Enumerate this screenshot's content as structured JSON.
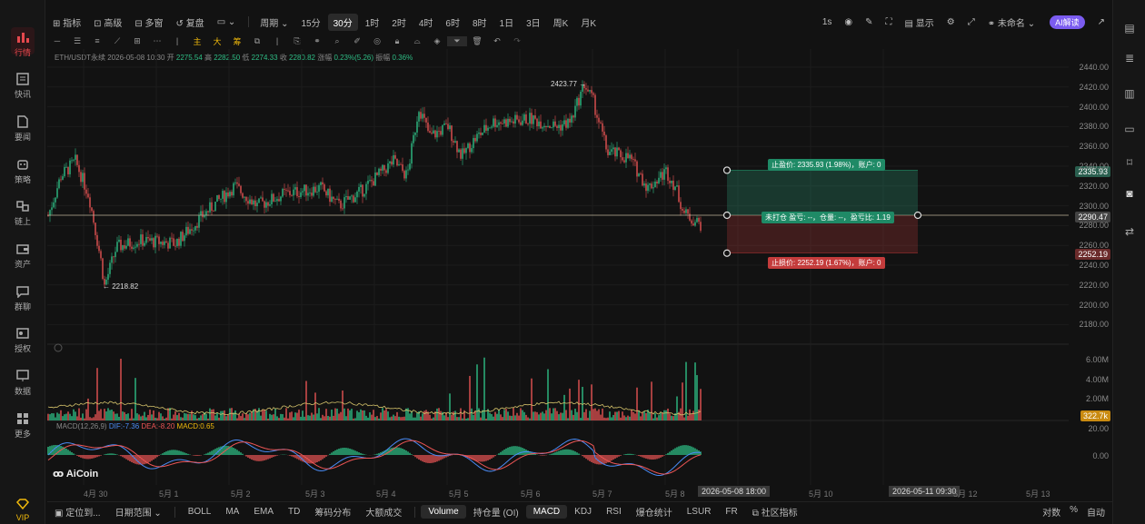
{
  "sidebar": {
    "items": [
      {
        "label": "行情",
        "icon": "bar-chart-icon",
        "active": true
      },
      {
        "label": "快讯",
        "icon": "news-icon"
      },
      {
        "label": "要闻",
        "icon": "document-icon"
      },
      {
        "label": "策略",
        "icon": "robot-icon"
      },
      {
        "label": "链上",
        "icon": "chain-icon"
      },
      {
        "label": "资产",
        "icon": "wallet-icon"
      },
      {
        "label": "群聊",
        "icon": "chat-icon"
      },
      {
        "label": "授权",
        "icon": "key-icon"
      },
      {
        "label": "数据",
        "icon": "monitor-icon"
      },
      {
        "label": "更多",
        "icon": "grid-icon"
      }
    ],
    "vip_label": "VIP"
  },
  "toolbar": {
    "indicators": "指标",
    "advanced": "高级",
    "multi_window": "多窗",
    "restore": "复盘",
    "period": "周期",
    "timeframes": [
      "15分",
      "30分",
      "1时",
      "2时",
      "4时",
      "6时",
      "8时",
      "1日",
      "3日",
      "周K",
      "月K"
    ],
    "selected_timeframe": "30分",
    "interval": "1s",
    "display": "显示",
    "unnamed": "未命名",
    "ai_button": "AI解读"
  },
  "drawing_tools": [
    "主",
    "大",
    "筹"
  ],
  "chart_info": {
    "symbol": "ETH/USDT永续",
    "time": "2026-05-08 10:30",
    "open_label": "开",
    "open": "2275.54",
    "high_label": "高",
    "high": "2282.50",
    "low_label": "低",
    "low": "2274.33",
    "close_label": "收",
    "close": "2280.82",
    "change_label": "涨幅",
    "change": "0.23%(5.26)",
    "amp_label": "振幅",
    "amp": "0.36%"
  },
  "price_axis": [
    "2440.00",
    "2420.00",
    "2400.00",
    "2380.00",
    "2360.00",
    "2340.00",
    "2320.00",
    "2300.00",
    "2280.00",
    "2260.00",
    "2240.00",
    "2220.00",
    "2200.00",
    "2180.00"
  ],
  "price_tags": {
    "take_profit": "2335.93",
    "current": "2290.47",
    "stop_loss": "2252.19"
  },
  "annotations": {
    "high": "2423.77",
    "low": "2218.82"
  },
  "position_tool": {
    "take_profit": "止盈价: 2335.93 (1.98%)，账户: 0",
    "open": "未打仓 盈亏: --，仓量: --，盈亏比: 1.19",
    "stop_loss": "止损价: 2252.19 (1.67%)，账户: 0"
  },
  "volume_axis": [
    "6.00M",
    "4.00M",
    "2.00M"
  ],
  "volume_tag": "322.7k",
  "macd": {
    "label": "MACD(12,26,9)",
    "dif": "DIF:-7.36",
    "dea": "DEA:-8.20",
    "macd": "MACD:0.65",
    "axis": [
      "20.00",
      "0.00"
    ]
  },
  "timeline": {
    "dates": [
      "4月 30",
      "5月 1",
      "5月 2",
      "5月 3",
      "5月 4",
      "5月 5",
      "5月 6",
      "5月 7",
      "5月 8",
      "5月 10",
      "5月 12",
      "5月 13"
    ],
    "cursor_label": "2026-05-08 18:00",
    "range_end_label": "2026-05-11 09:30"
  },
  "brand": "AiCoin",
  "bottom_bar": {
    "locate": "定位到...",
    "date_range": "日期范围",
    "indicators": [
      "BOLL",
      "MA",
      "EMA",
      "TD",
      "筹码分布",
      "大额成交",
      "Volume",
      "持仓量 (OI)",
      "MACD",
      "KDJ",
      "RSI",
      "爆仓统计",
      "LSUR",
      "FR"
    ],
    "selected": [
      "Volume",
      "MACD"
    ],
    "community": "社区指标",
    "right": [
      "对数",
      "%",
      "自动"
    ]
  },
  "colors": {
    "up": "#2ebd85",
    "down": "#e55353",
    "background": "#121212",
    "accent": "#7b5cf0"
  },
  "chart_data": {
    "type": "line",
    "xlabel": "",
    "ylabel": "",
    "ylim": [
      2170,
      2450
    ],
    "x": [
      "4月 30",
      "5月 1",
      "5月 2",
      "5月 3",
      "5月 4",
      "5月 5",
      "5月 6",
      "5月 7",
      "5月 8"
    ],
    "series": [
      {
        "values": [
          2300,
          2245,
          2275,
          2300,
          2345,
          2380,
          2395,
          2423.77,
          2290.47
        ]
      }
    ]
  }
}
